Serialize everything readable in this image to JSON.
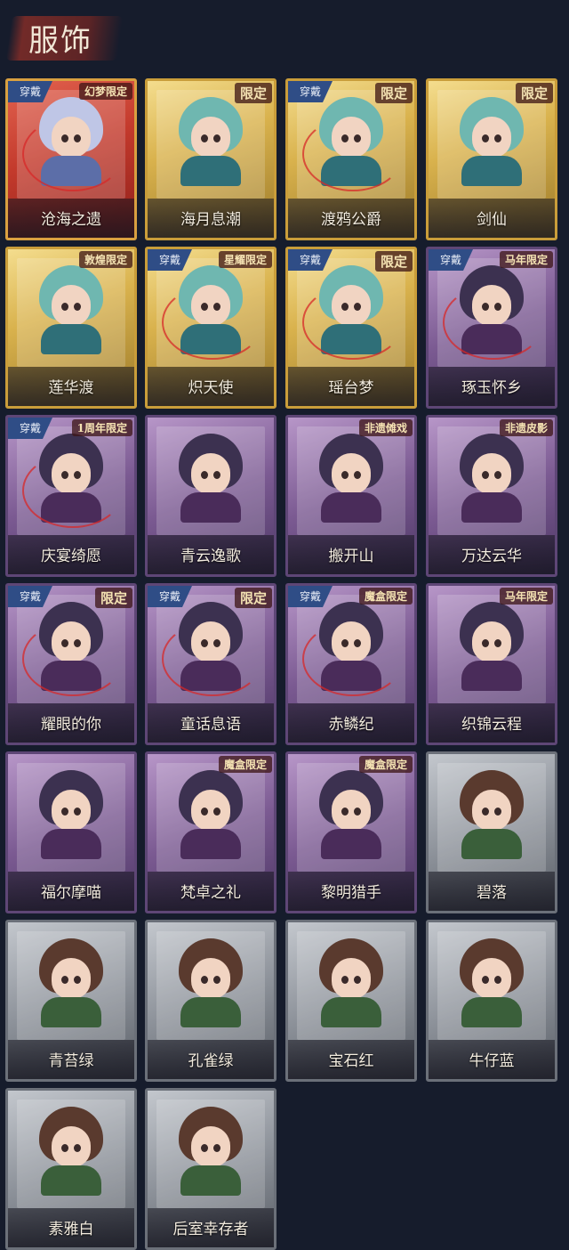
{
  "page": {
    "title": "服饰"
  },
  "labels": {
    "equipped": "穿戴"
  },
  "colors": {
    "background": "#161c2c",
    "equipped_badge": "#2f4d86",
    "name_text": "#f3ecdf"
  },
  "outfits": [
    {
      "name": "沧海之遗",
      "tier": "red",
      "equipped": true,
      "tag": "幻梦限定"
    },
    {
      "name": "海月息潮",
      "tier": "gold",
      "equipped": false,
      "tag": "限定"
    },
    {
      "name": "渡鸦公爵",
      "tier": "gold",
      "equipped": true,
      "tag": "限定"
    },
    {
      "name": "剑仙",
      "tier": "gold",
      "equipped": false,
      "tag": "限定"
    },
    {
      "name": "莲华渡",
      "tier": "gold",
      "equipped": false,
      "tag": "敦煌限定"
    },
    {
      "name": "炽天使",
      "tier": "gold",
      "equipped": true,
      "tag": "星耀限定"
    },
    {
      "name": "瑶台梦",
      "tier": "gold",
      "equipped": true,
      "tag": "限定"
    },
    {
      "name": "琢玉怀乡",
      "tier": "purple",
      "equipped": true,
      "tag": "马年限定"
    },
    {
      "name": "庆宴绮愿",
      "tier": "purple",
      "equipped": true,
      "tag": "1周年限定"
    },
    {
      "name": "青云逸歌",
      "tier": "purple",
      "equipped": false,
      "tag": ""
    },
    {
      "name": "搬开山",
      "tier": "purple",
      "equipped": false,
      "tag": "非遗傩戏"
    },
    {
      "name": "万达云华",
      "tier": "purple",
      "equipped": false,
      "tag": "非遗皮影"
    },
    {
      "name": "耀眼的你",
      "tier": "purple",
      "equipped": true,
      "tag": "限定"
    },
    {
      "name": "童话息语",
      "tier": "purple",
      "equipped": true,
      "tag": "限定"
    },
    {
      "name": "赤鳞纪",
      "tier": "purple",
      "equipped": true,
      "tag": "魔盒限定"
    },
    {
      "name": "织锦云程",
      "tier": "purple",
      "equipped": false,
      "tag": "马年限定"
    },
    {
      "name": "福尔摩喵",
      "tier": "purple",
      "equipped": false,
      "tag": ""
    },
    {
      "name": "梵卓之礼",
      "tier": "purple",
      "equipped": false,
      "tag": "魔盒限定"
    },
    {
      "name": "黎明猎手",
      "tier": "purple",
      "equipped": false,
      "tag": "魔盒限定"
    },
    {
      "name": "碧落",
      "tier": "grey",
      "equipped": false,
      "tag": ""
    },
    {
      "name": "青苔绿",
      "tier": "grey",
      "equipped": false,
      "tag": ""
    },
    {
      "name": "孔雀绿",
      "tier": "grey",
      "equipped": false,
      "tag": ""
    },
    {
      "name": "宝石红",
      "tier": "grey",
      "equipped": false,
      "tag": ""
    },
    {
      "name": "牛仔蓝",
      "tier": "grey",
      "equipped": false,
      "tag": ""
    },
    {
      "name": "素雅白",
      "tier": "grey",
      "equipped": false,
      "tag": ""
    },
    {
      "name": "后室幸存者",
      "tier": "grey",
      "equipped": false,
      "tag": ""
    }
  ]
}
